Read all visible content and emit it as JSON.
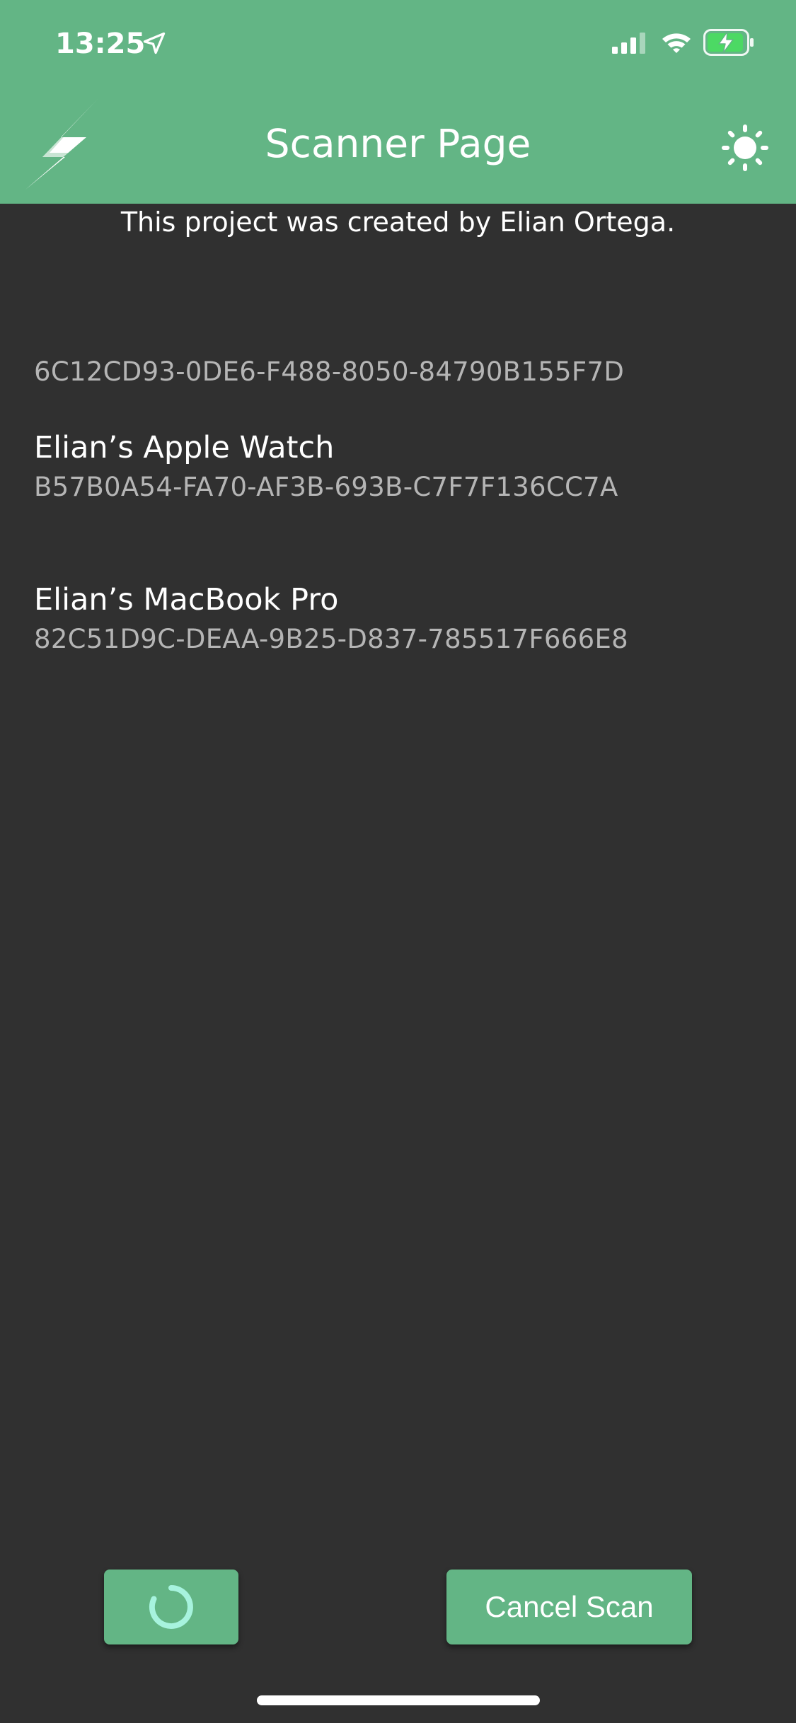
{
  "status_bar": {
    "time": "13:25"
  },
  "appbar": {
    "title": "Scanner Page",
    "logo_icon": "lightning-bolt-icon",
    "theme_icon": "sun-icon",
    "background_color": "#63b585"
  },
  "credit": "This project was created by Elian Ortega.",
  "devices": [
    {
      "name": "",
      "id": "6C12CD93-0DE6-F488-8050-84790B155F7D"
    },
    {
      "name": "Elian’s Apple Watch",
      "id": "B57B0A54-FA70-AF3B-693B-C7F7F136CC7A"
    },
    {
      "name": "Elian’s MacBook Pro",
      "id": "82C51D9C-DEAA-9B25-D837-785517F666E8"
    }
  ],
  "buttons": {
    "spinner_icon": "loading-spinner-icon",
    "cancel_label": "Cancel Scan"
  },
  "colors": {
    "accent": "#63b585",
    "background": "#303030",
    "spinner": "#a7f3de"
  }
}
